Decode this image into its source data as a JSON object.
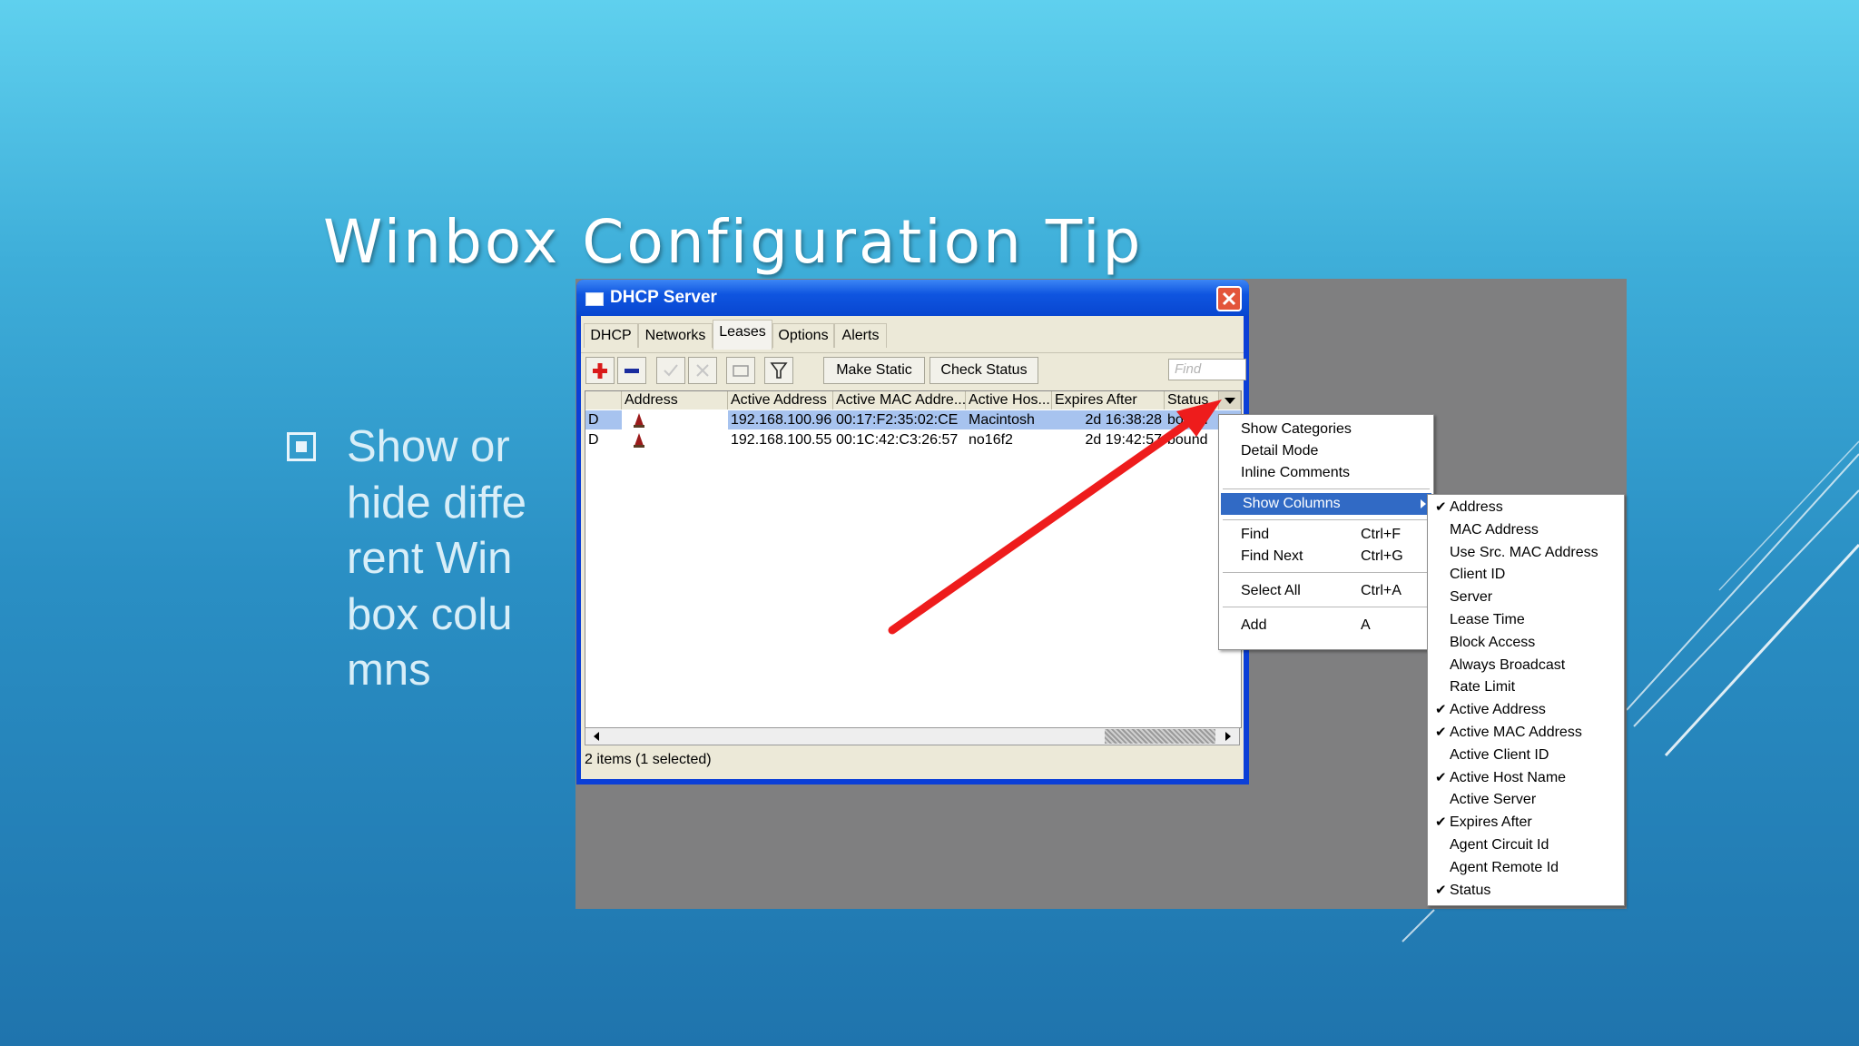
{
  "slide": {
    "title": "Winbox Configuration Tip",
    "bullet": "Show or hide different Winbox columns"
  },
  "window": {
    "title": "DHCP Server",
    "tabs": [
      "DHCP",
      "Networks",
      "Leases",
      "Options",
      "Alerts"
    ],
    "active_tab": "Leases",
    "toolbar": {
      "make_static": "Make Static",
      "check_status": "Check Status",
      "find_placeholder": "Find"
    },
    "columns": [
      "",
      "Address",
      "Active Address",
      "Active MAC Addre...",
      "Active Hos...",
      "Expires After",
      "Status"
    ],
    "rows": [
      {
        "flag": "D",
        "address": "",
        "active_address": "192.168.100.96",
        "active_mac": "00:17:F2:35:02:CE",
        "active_host": "Macintosh",
        "expires_after": "2d 16:38:28",
        "status": "bound",
        "selected": true
      },
      {
        "flag": "D",
        "address": "",
        "active_address": "192.168.100.55",
        "active_mac": "00:1C:42:C3:26:57",
        "active_host": "no16f2",
        "expires_after": "2d 19:42:57",
        "status": "bound",
        "selected": false
      }
    ],
    "status_text": "2 items (1 selected)"
  },
  "context_menu": {
    "show_categories": "Show Categories",
    "detail_mode": "Detail Mode",
    "inline_comments": "Inline Comments",
    "show_columns": "Show Columns",
    "find": "Find",
    "find_sc": "Ctrl+F",
    "find_next": "Find Next",
    "find_next_sc": "Ctrl+G",
    "select_all": "Select All",
    "select_all_sc": "Ctrl+A",
    "add": "Add",
    "add_sc": "A"
  },
  "columns_menu": [
    {
      "label": "Address",
      "checked": true
    },
    {
      "label": "MAC Address",
      "checked": false
    },
    {
      "label": "Use Src. MAC Address",
      "checked": false
    },
    {
      "label": "Client ID",
      "checked": false
    },
    {
      "label": "Server",
      "checked": false
    },
    {
      "label": "Lease Time",
      "checked": false
    },
    {
      "label": "Block Access",
      "checked": false
    },
    {
      "label": "Always Broadcast",
      "checked": false
    },
    {
      "label": "Rate Limit",
      "checked": false
    },
    {
      "label": "Active Address",
      "checked": true
    },
    {
      "label": "Active MAC Address",
      "checked": true
    },
    {
      "label": "Active Client ID",
      "checked": false
    },
    {
      "label": "Active Host Name",
      "checked": true
    },
    {
      "label": "Active Server",
      "checked": false
    },
    {
      "label": "Expires After",
      "checked": true
    },
    {
      "label": "Agent Circuit Id",
      "checked": false
    },
    {
      "label": "Agent Remote Id",
      "checked": false
    },
    {
      "label": "Status",
      "checked": true
    }
  ],
  "colors": {
    "accent_arrow": "#ee1c1c",
    "menu_highlight": "#316ac5",
    "selected_row": "#a7c3ef"
  }
}
